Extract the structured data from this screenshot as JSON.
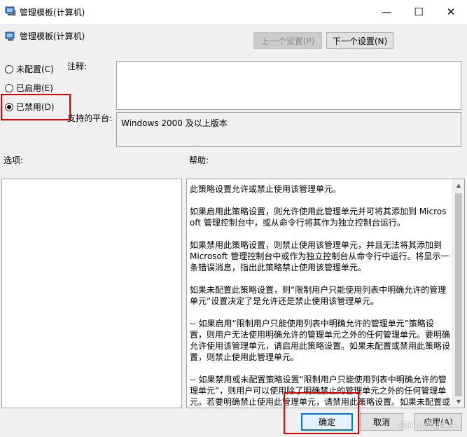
{
  "window": {
    "title": "管理模板(计算机)",
    "minimize_glyph": "—",
    "maximize_glyph": "☐",
    "close_glyph": "✕"
  },
  "header": {
    "title": "管理模板(计算机)",
    "prev_button": "上一个设置(P)",
    "next_button": "下一个设置(N)"
  },
  "options": {
    "not_configured": "未配置(C)",
    "enabled": "已启用(E)",
    "disabled": "已禁用(D)",
    "selected": "disabled"
  },
  "comment": {
    "label": "注释:",
    "value": ""
  },
  "platform": {
    "label": "支持的平台:",
    "value": "Windows 2000 及以上版本"
  },
  "sections": {
    "options_label": "选项:",
    "help_label": "帮助:"
  },
  "help": {
    "text": "此策略设置允许或禁止使用该管理单元。\n\n如果启用此策略设置，则允许使用此管理单元并可将其添加到 Microsoft 管理控制台中，或从命令行将其作为独立控制台运行。\n\n如果禁用此策略设置，则禁止使用该管理单元，并且无法将其添加到 Microsoft 管理控制台中或作为独立控制台从命令行中运行。将显示一条错误消息，指出此策略禁止使用该管理单元。\n\n如果未配置此策略设置，则“限制用户只能使用列表中明确允许的管理单元”设置决定了是允许还是禁止使用该管理单元。\n\n-- 如果启用“限制用户只能使用列表中明确允许的管理单元”策略设置，则用户无法使用明确允许的管理单元之外的任何管理单元。要明确允许使用该管理单元，请启用此策略设置。如果未配置或禁用此策略设置，则禁止使用此管理单元。\n\n-- 如果禁用或未配置策略设置“限制用户只能使用列表中明确允许的管理单元”，则用户可以使用除了明确禁止的管理单元之外的任何管理单元。若要明确禁止使用此管理单元，请禁用此策略设置。如果未配置或启用此策略设置，则允许使用该管理单元。"
  },
  "footer": {
    "ok": "确定",
    "cancel": "取消",
    "apply": "应用(A)"
  },
  "watermark": "CSDN @别秃头",
  "colors": {
    "highlight_box": "#e00000",
    "default_button_border": "#0078d7"
  }
}
